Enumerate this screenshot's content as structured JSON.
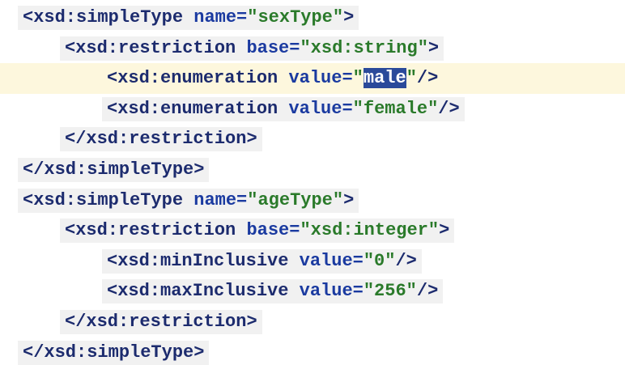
{
  "editor": {
    "lines": [
      {
        "indent": 0,
        "parts": [
          {
            "t": "<",
            "c": "bracket"
          },
          {
            "t": "xsd:simpleType",
            "c": "tag"
          },
          {
            "t": " ",
            "c": "tag"
          },
          {
            "t": "name=",
            "c": "attr"
          },
          {
            "t": "\"sexType\"",
            "c": "str"
          },
          {
            "t": ">",
            "c": "bracket"
          }
        ]
      },
      {
        "indent": 1,
        "parts": [
          {
            "t": "<",
            "c": "bracket"
          },
          {
            "t": "xsd:restriction",
            "c": "tag"
          },
          {
            "t": " ",
            "c": "tag"
          },
          {
            "t": "base=",
            "c": "attr"
          },
          {
            "t": "\"xsd:string\"",
            "c": "str"
          },
          {
            "t": ">",
            "c": "bracket"
          }
        ]
      },
      {
        "indent": 2,
        "caret": true,
        "parts": [
          {
            "t": "<",
            "c": "bracket"
          },
          {
            "t": "xsd:enumeration",
            "c": "tag"
          },
          {
            "t": " ",
            "c": "tag"
          },
          {
            "t": "value=",
            "c": "attr"
          },
          {
            "t": "\"",
            "c": "str"
          },
          {
            "t": "male",
            "c": "sel"
          },
          {
            "t": "\"",
            "c": "str"
          },
          {
            "t": "/>",
            "c": "bracket"
          }
        ]
      },
      {
        "indent": 2,
        "parts": [
          {
            "t": "<",
            "c": "bracket"
          },
          {
            "t": "xsd:enumeration",
            "c": "tag"
          },
          {
            "t": " ",
            "c": "tag"
          },
          {
            "t": "value=",
            "c": "attr"
          },
          {
            "t": "\"female\"",
            "c": "str"
          },
          {
            "t": "/>",
            "c": "bracket"
          }
        ]
      },
      {
        "indent": 1,
        "parts": [
          {
            "t": "</",
            "c": "bracket"
          },
          {
            "t": "xsd:restriction",
            "c": "tag"
          },
          {
            "t": ">",
            "c": "bracket"
          }
        ]
      },
      {
        "indent": 0,
        "parts": [
          {
            "t": "</",
            "c": "bracket"
          },
          {
            "t": "xsd:simpleType",
            "c": "tag"
          },
          {
            "t": ">",
            "c": "bracket"
          }
        ]
      },
      {
        "indent": 0,
        "parts": [
          {
            "t": "<",
            "c": "bracket"
          },
          {
            "t": "xsd:simpleType",
            "c": "tag"
          },
          {
            "t": " ",
            "c": "tag"
          },
          {
            "t": "name=",
            "c": "attr"
          },
          {
            "t": "\"ageType\"",
            "c": "str"
          },
          {
            "t": ">",
            "c": "bracket"
          }
        ]
      },
      {
        "indent": 1,
        "parts": [
          {
            "t": "<",
            "c": "bracket"
          },
          {
            "t": "xsd:restriction",
            "c": "tag"
          },
          {
            "t": " ",
            "c": "tag"
          },
          {
            "t": "base=",
            "c": "attr"
          },
          {
            "t": "\"xsd:integer\"",
            "c": "str"
          },
          {
            "t": ">",
            "c": "bracket"
          }
        ]
      },
      {
        "indent": 2,
        "parts": [
          {
            "t": "<",
            "c": "bracket"
          },
          {
            "t": "xsd:minInclusive",
            "c": "tag"
          },
          {
            "t": " ",
            "c": "tag"
          },
          {
            "t": "value=",
            "c": "attr"
          },
          {
            "t": "\"0\"",
            "c": "str"
          },
          {
            "t": "/>",
            "c": "bracket"
          }
        ]
      },
      {
        "indent": 2,
        "parts": [
          {
            "t": "<",
            "c": "bracket"
          },
          {
            "t": "xsd:maxInclusive",
            "c": "tag"
          },
          {
            "t": " ",
            "c": "tag"
          },
          {
            "t": "value=",
            "c": "attr"
          },
          {
            "t": "\"256\"",
            "c": "str"
          },
          {
            "t": "/>",
            "c": "bracket"
          }
        ]
      },
      {
        "indent": 1,
        "parts": [
          {
            "t": "</",
            "c": "bracket"
          },
          {
            "t": "xsd:restriction",
            "c": "tag"
          },
          {
            "t": ">",
            "c": "bracket"
          }
        ]
      },
      {
        "indent": 0,
        "parts": [
          {
            "t": "</",
            "c": "bracket"
          },
          {
            "t": "xsd:simpleType",
            "c": "tag"
          },
          {
            "t": ">",
            "c": "bracket"
          }
        ]
      }
    ]
  },
  "colors": {
    "background": "#ffffff",
    "caret_row": "#fdf7dd",
    "line_shade": "#f1f1f1",
    "selection": "#2a4a9a",
    "tag": "#1c2b6e",
    "attribute": "#1a3aa0",
    "string": "#2a7a2a"
  }
}
